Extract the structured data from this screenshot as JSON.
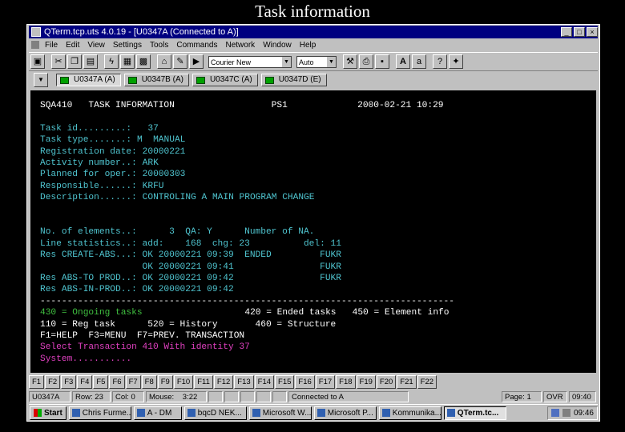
{
  "slide_title": "Task information",
  "window": {
    "title": "QTerm.tcp.uts 4.0.19 - [U0347A (Connected to A)]",
    "controls": [
      "_",
      "□",
      "×"
    ]
  },
  "menu": [
    "File",
    "Edit",
    "View",
    "Settings",
    "Tools",
    "Commands",
    "Network",
    "Window",
    "Help"
  ],
  "toolbar": {
    "font_select": "Courier New",
    "size_select": "Auto",
    "buttons": [
      "print-icon",
      "cut-icon",
      "copy-icon",
      "paste-icon",
      "lightning-icon",
      "keyboard-icon",
      "keyboard-alt-icon",
      "home-icon",
      "pen-icon",
      "play-icon",
      "tools-icon",
      "printer-icon",
      "save-icon",
      "font-icon",
      "text-icon",
      "help-icon",
      "context-help-icon"
    ]
  },
  "sessions": [
    {
      "label": "U0347A (A)",
      "active": true
    },
    {
      "label": "U0347B (A)",
      "active": false
    },
    {
      "label": "U0347C (A)",
      "active": false
    },
    {
      "label": "U0347D (E)",
      "active": false
    }
  ],
  "colors": {
    "white": "#ffffff",
    "cyan": "#4fc4cf",
    "green": "#40c040",
    "magenta": "#e040c0"
  },
  "terminal": {
    "lines": [
      {
        "row": 0,
        "segs": [
          {
            "col": 0,
            "text": "SQA410   TASK INFORMATION                  PS1             2000-02-21 10:29",
            "color": "white"
          }
        ]
      },
      {
        "row": 2,
        "segs": [
          {
            "col": 0,
            "text": "Task id.........:",
            "color": "cyan"
          },
          {
            "col": 17,
            "text": "   37",
            "color": "cyan"
          }
        ]
      },
      {
        "row": 3,
        "segs": [
          {
            "col": 0,
            "text": "Task type.......:",
            "color": "cyan"
          },
          {
            "col": 17,
            "text": " M  MANUAL",
            "color": "cyan"
          }
        ]
      },
      {
        "row": 4,
        "segs": [
          {
            "col": 0,
            "text": "Registration date:",
            "color": "cyan"
          },
          {
            "col": 18,
            "text": " 20000221",
            "color": "cyan"
          }
        ]
      },
      {
        "row": 5,
        "segs": [
          {
            "col": 0,
            "text": "Activity number..:",
            "color": "cyan"
          },
          {
            "col": 18,
            "text": " ARK",
            "color": "cyan"
          }
        ]
      },
      {
        "row": 6,
        "segs": [
          {
            "col": 0,
            "text": "Planned for oper.:",
            "color": "cyan"
          },
          {
            "col": 18,
            "text": " 20000303",
            "color": "cyan"
          }
        ]
      },
      {
        "row": 7,
        "segs": [
          {
            "col": 0,
            "text": "Responsible......:",
            "color": "cyan"
          },
          {
            "col": 18,
            "text": " KRFU",
            "color": "cyan"
          }
        ]
      },
      {
        "row": 8,
        "segs": [
          {
            "col": 0,
            "text": "Description......:",
            "color": "cyan"
          },
          {
            "col": 18,
            "text": " CONTROLING A MAIN PROGRAM CHANGE",
            "color": "cyan"
          }
        ]
      },
      {
        "row": 11,
        "segs": [
          {
            "col": 0,
            "text": "No. of elements..:      3  QA: Y      Number of NA.",
            "color": "cyan"
          }
        ]
      },
      {
        "row": 12,
        "segs": [
          {
            "col": 0,
            "text": "Line statistics..: add:    168  chg: 23          del: 11",
            "color": "cyan"
          }
        ]
      },
      {
        "row": 13,
        "segs": [
          {
            "col": 0,
            "text": "Res CREATE-ABS...: OK 20000221 09:39  ENDED         FUKR",
            "color": "cyan"
          }
        ]
      },
      {
        "row": 14,
        "segs": [
          {
            "col": 0,
            "text": "                   OK 20000221 09:41                FUKR",
            "color": "cyan"
          }
        ]
      },
      {
        "row": 15,
        "segs": [
          {
            "col": 0,
            "text": "Res ABS-TO PROD..: OK 20000221 09:42                FUKR",
            "color": "cyan"
          }
        ]
      },
      {
        "row": 16,
        "segs": [
          {
            "col": 0,
            "text": "Res ABS-IN-PROD..: OK 20000221 09:42",
            "color": "cyan"
          }
        ]
      },
      {
        "row": 17,
        "segs": [
          {
            "col": 0,
            "text": "-----------------------------------------------------------------------------",
            "color": "white"
          }
        ]
      },
      {
        "row": 18,
        "segs": [
          {
            "col": 0,
            "text": "430 = Ongoing tasks",
            "color": "green"
          },
          {
            "col": 38,
            "text": "420 = Ended tasks   450 = Element info",
            "color": "white"
          }
        ]
      },
      {
        "row": 19,
        "segs": [
          {
            "col": 0,
            "text": "110 = Reg task      520 = History       460 = Structure",
            "color": "white"
          }
        ]
      },
      {
        "row": 20,
        "segs": [
          {
            "col": 0,
            "text": "F1=HELP  F3=MENU  F7=PREV. TRANSACTION",
            "color": "white"
          }
        ]
      },
      {
        "row": 21,
        "segs": [
          {
            "col": 0,
            "text": "Select Transaction 410 With identity 37",
            "color": "magenta"
          }
        ]
      },
      {
        "row": 22,
        "segs": [
          {
            "col": 0,
            "text": "System...........",
            "color": "magenta"
          }
        ]
      }
    ]
  },
  "fkeys": [
    "F1",
    "F2",
    "F3",
    "F4",
    "F5",
    "F6",
    "F7",
    "F8",
    "F9",
    "F10",
    "F11",
    "F12",
    "F13",
    "F14",
    "F15",
    "F16",
    "F17",
    "F18",
    "F19",
    "F20",
    "F21",
    "F22"
  ],
  "status": {
    "session": "U0347A",
    "row": "Row: 23",
    "col": "Col: 0",
    "mouse": "Mouse:",
    "mouse_pos": "3:22",
    "connection": "Connected to A",
    "page": "Page: 1",
    "mode": "OVR",
    "time": "09:40"
  },
  "taskbar": {
    "start": "Start",
    "tasks": [
      {
        "label": "Chris Furme...",
        "active": false
      },
      {
        "label": "A - DM",
        "active": false
      },
      {
        "label": "bqcD NEK...",
        "active": false
      },
      {
        "label": "Microsoft W...",
        "active": false
      },
      {
        "label": "Microsoft P...",
        "active": false
      },
      {
        "label": "Kommunika...",
        "active": false
      },
      {
        "label": "QTerm.tc...",
        "active": true
      }
    ],
    "clock": "09:46"
  }
}
